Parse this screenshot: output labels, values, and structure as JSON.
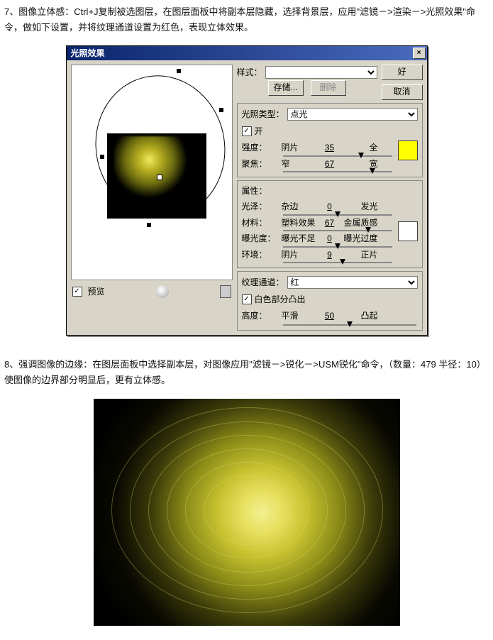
{
  "para7": "7、图像立体感：Ctrl+J复制被选图层，在图层面板中将副本层隐藏，选择背景层，应用\"滤镜－>渲染－>光照效果\"命令，做如下设置，并将纹理通道设置为红色，表现立体效果。",
  "para8": "8、强调图像的边缘：在图层面板中选择副本层，对图像应用\"滤镜－>锐化－>USM锐化\"命令，（数量：479 半径：10）使图像的边界部分明显后，更有立体感。",
  "dialog": {
    "title": "光照效果",
    "close": "×",
    "preview_label": "预览",
    "style_label": "样式：",
    "save": "存储...",
    "delete": "删除",
    "ok": "好",
    "cancel": "取消",
    "light_type_label": "光照类型：",
    "light_type_value": "点光",
    "on_label": "开",
    "sliders1": [
      {
        "name": "强度：",
        "l": "阴片",
        "v": "35",
        "r": "全",
        "pos": 72
      },
      {
        "name": "聚焦：",
        "l": "窄",
        "v": "67",
        "r": "宽",
        "pos": 82
      }
    ],
    "props_label": "属性：",
    "sliders2": [
      {
        "name": "光泽：",
        "l": "杂边",
        "v": "0",
        "r": "发光",
        "pos": 50
      },
      {
        "name": "材料：",
        "l": "塑料效果",
        "v": "67",
        "r": "金属质感",
        "pos": 78
      },
      {
        "name": "曝光度：",
        "l": "曝光不足",
        "v": "0",
        "r": "曝光过度",
        "pos": 50
      },
      {
        "name": "环境：",
        "l": "阴片",
        "v": "9",
        "r": "正片",
        "pos": 55
      }
    ],
    "texture_channel_label": "纹理通道：",
    "texture_channel_value": "红",
    "white_high_label": "白色部分凸出",
    "height_label": "高度：",
    "height_l": "平滑",
    "height_v": "50",
    "height_r": "凸起",
    "height_pos": 50
  }
}
